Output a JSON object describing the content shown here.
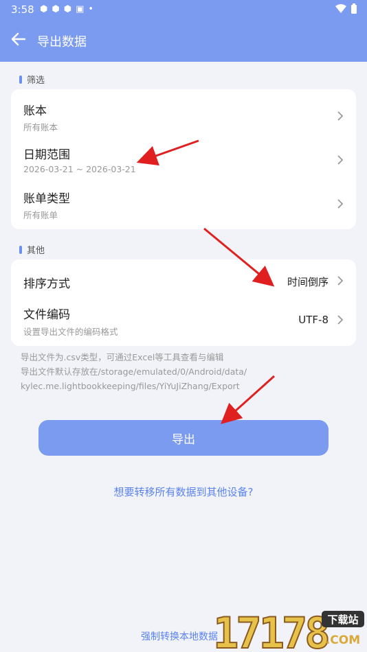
{
  "status": {
    "time": "3:58"
  },
  "appbar": {
    "title": "导出数据"
  },
  "filter": {
    "label": "筛选",
    "ledger_title": "账本",
    "ledger_value": "所有账本",
    "date_title": "日期范围",
    "date_value": "2026-03-21 ~ 2026-03-21",
    "type_title": "账单类型",
    "type_value": "所有账单"
  },
  "other": {
    "label": "其他",
    "sort_title": "排序方式",
    "sort_value": "时间倒序",
    "encoding_title": "文件编码",
    "encoding_sub": "设置导出文件的编码格式",
    "encoding_value": "UTF-8"
  },
  "notes": [
    "导出文件为.csv类型，可通过Excel等工具查看与编辑",
    "导出文件默认存放在/storage/emulated/0/Android/data/",
    "kylec.me.lightbookkeeping/files/YiYuJiZhang/Export"
  ],
  "buttons": {
    "export": "导出",
    "transfer": "想要转移所有数据到其他设备?",
    "force_convert": "强制转换本地数据"
  },
  "watermark": {
    "digits": "17178",
    "tag": "下载站",
    "com": ".COM"
  },
  "colors": {
    "primary": "#7b9bf0",
    "link": "#5b83f0",
    "arrow": "#e02020",
    "background": "#f1f3f8"
  }
}
